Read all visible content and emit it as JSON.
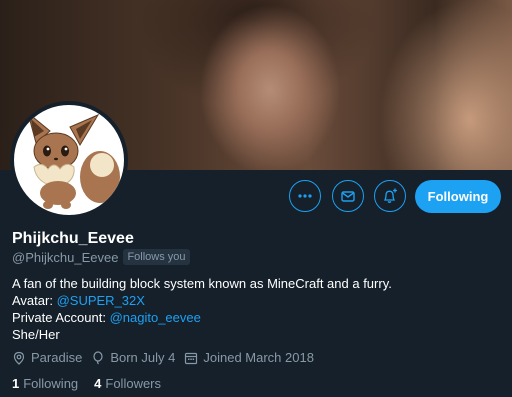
{
  "profile": {
    "display_name": "Phijkchu_Eevee",
    "handle": "@Phijkchu_Eevee",
    "follows_you_badge": "Follows you",
    "bio": {
      "line1": "A fan of the building block system known as MineCraft and a furry.",
      "avatar_label": "Avatar:",
      "avatar_link": "@SUPER_32X",
      "private_label": "Private Account:",
      "private_link": "@nagito_eevee",
      "line4": "She/Her"
    },
    "location": "Paradise",
    "birthday": "Born July 4",
    "joined": "Joined March 2018"
  },
  "stats": {
    "following_count": "1",
    "following_label": "Following",
    "followers_count": "4",
    "followers_label": "Followers"
  },
  "actions": {
    "follow_button_label": "Following",
    "more_icon": "more-icon",
    "message_icon": "envelope-icon",
    "notify_icon": "bell-plus-icon"
  },
  "colors": {
    "background": "#15202b",
    "accent": "#1da1f2",
    "secondary_text": "#8899a6"
  }
}
